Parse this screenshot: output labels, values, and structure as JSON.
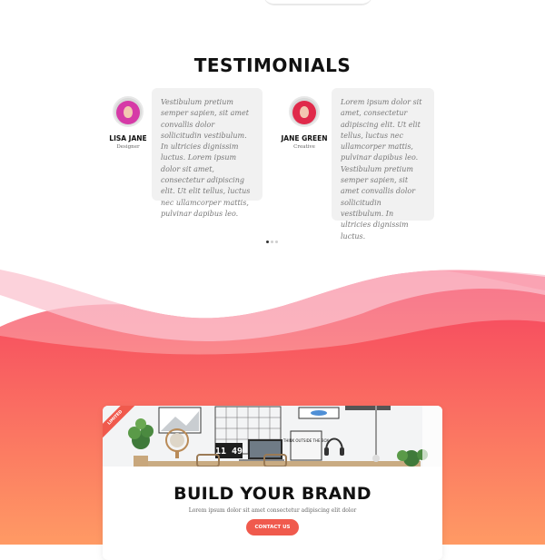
{
  "testimonials": {
    "title": "TESTIMONIALS",
    "items": [
      {
        "name": "LISA JANE",
        "role": "Designer",
        "quote": "Vestibulum pretium semper sapien, sit amet convallis dolor sollicitudin vestibulum. In ultricies dignissim luctus. Lorem ipsum dolor sit amet, consectetur adipiscing elit. Ut elit tellus, luctus nec ullamcorper mattis, pulvinar dapibus leo."
      },
      {
        "name": "JANE GREEN",
        "role": "Creative",
        "quote": "Lorem ipsum dolor sit amet, consectetur adipiscing elit. Ut elit tellus, luctus nec ullamcorper mattis, pulvinar dapibus leo. Vestibulum pretium semper sapien, sit amet convallis dolor sollicitudin vestibulum. In ultricies dignissim luctus."
      }
    ],
    "pagination_count": 3,
    "pagination_active": 1
  },
  "promo": {
    "ribbon": "LIMITED",
    "title": "BUILD YOUR BRAND",
    "subtitle": "Lorem ipsum dolor sit amet consectetur adipiscing elit dolor",
    "button_label": "CONTACT US",
    "clock_text": "11 49",
    "lightbox_text": "THINK OUTSIDE THE BOX"
  },
  "colors": {
    "accent": "#f05a4d",
    "gradient_top": "#f5405f",
    "gradient_bottom": "#ff9a64"
  }
}
